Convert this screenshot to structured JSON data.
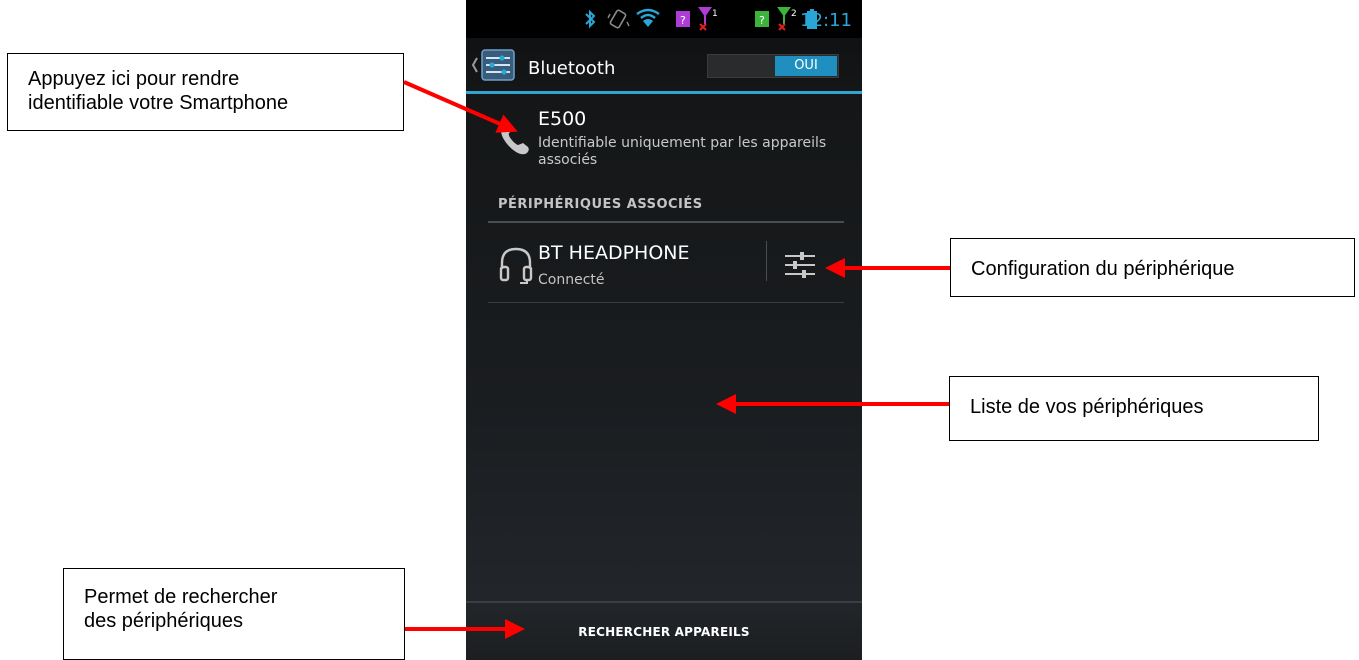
{
  "annotations": {
    "identify": "Appuyez ici pour rendre\nidentifiable votre Smartphone",
    "config": "Configuration du périphérique",
    "list": "Liste de vos périphériques",
    "search": "Permet de rechercher\ndes périphériques"
  },
  "statusbar": {
    "time": "12:11",
    "icons": [
      "bluetooth-icon",
      "vibrate-icon",
      "wifi-icon",
      "sim1-icon",
      "signal1-icon",
      "sim2-icon",
      "signal2-icon",
      "battery-icon"
    ],
    "sim1_color": "#b03cd8",
    "sim2_color": "#3cb43c",
    "accent": "#2aa6d6"
  },
  "actionbar": {
    "title": "Bluetooth",
    "toggle_label": "OUI"
  },
  "this_device": {
    "name": "E500",
    "description": "Identifiable uniquement par les appareils associés"
  },
  "paired": {
    "header": "PÉRIPHÉRIQUES ASSOCIÉS",
    "devices": [
      {
        "name": "BT HEADPHONE",
        "status": "Connecté"
      }
    ]
  },
  "bottom_button": "RECHERCHER APPAREILS",
  "arrow_color": "#ff0000"
}
